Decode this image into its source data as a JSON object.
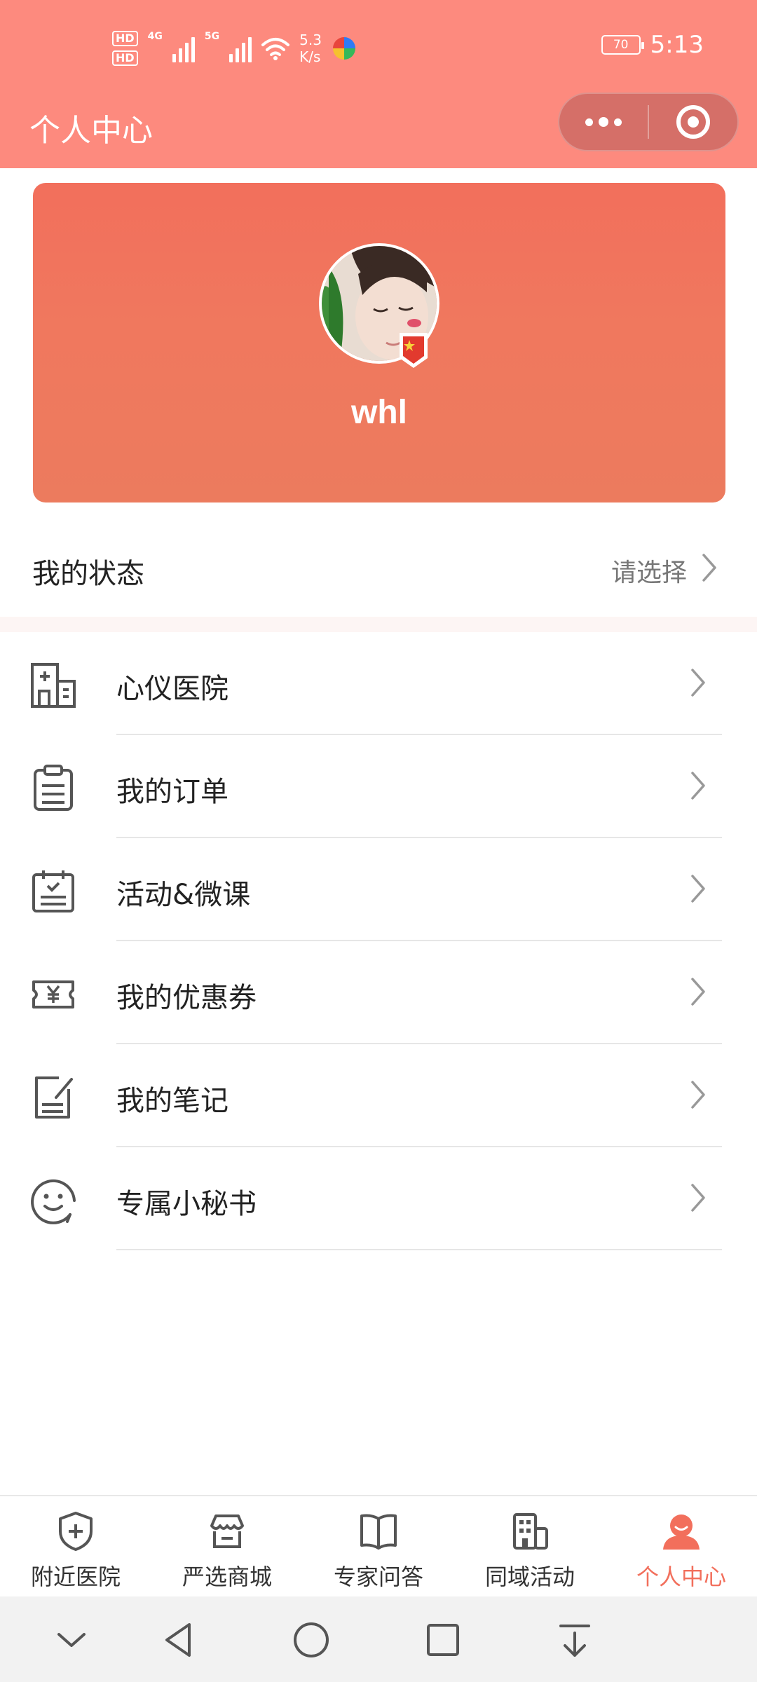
{
  "status_bar": {
    "hd1": "HD",
    "hd2": "HD",
    "net1": "4G",
    "net2": "5G",
    "speed_value": "5.3",
    "speed_unit": "K/s",
    "battery": "70",
    "time": "5:13"
  },
  "header": {
    "title": "个人中心"
  },
  "profile": {
    "username": "whl"
  },
  "status_row": {
    "label": "我的状态",
    "value": "请选择"
  },
  "menu": {
    "items": [
      {
        "label": "心仪医院",
        "icon": "hospital-icon"
      },
      {
        "label": "我的订单",
        "icon": "clipboard-icon"
      },
      {
        "label": "活动&微课",
        "icon": "calendar-check-icon"
      },
      {
        "label": "我的优惠券",
        "icon": "coupon-icon"
      },
      {
        "label": "我的笔记",
        "icon": "note-edit-icon"
      },
      {
        "label": "专属小秘书",
        "icon": "smiley-icon"
      }
    ]
  },
  "tabbar": {
    "items": [
      {
        "label": "附近医院",
        "icon": "shield-plus-icon",
        "active": false
      },
      {
        "label": "严选商城",
        "icon": "store-icon",
        "active": false
      },
      {
        "label": "专家问答",
        "icon": "book-icon",
        "active": false
      },
      {
        "label": "同域活动",
        "icon": "building-icon",
        "active": false
      },
      {
        "label": "个人中心",
        "icon": "person-icon",
        "active": true
      }
    ]
  },
  "colors": {
    "header_bg": "#FD8A7E",
    "accent": "#F26F5C",
    "card_top": "#F26F5C",
    "card_bottom": "#EC7B5E"
  }
}
